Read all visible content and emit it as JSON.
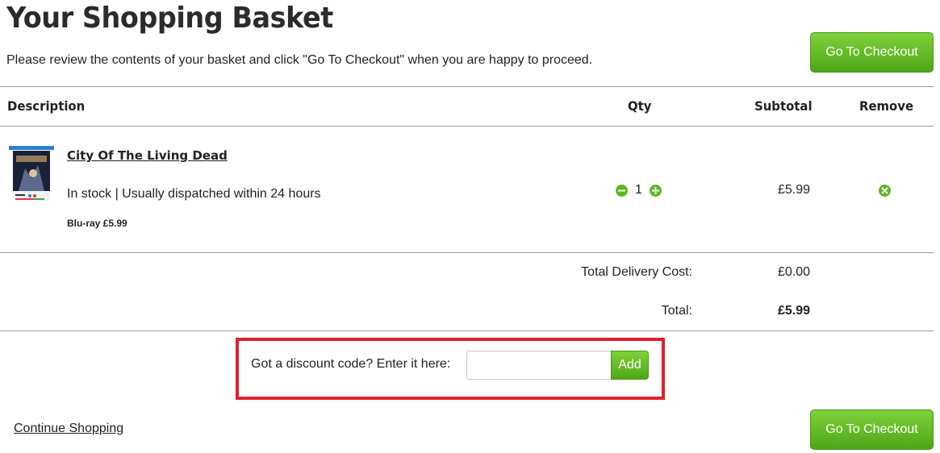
{
  "header": {
    "title": "Your Shopping Basket",
    "intro": "Please review the contents of your basket and click \"Go To Checkout\" when you are happy to proceed.",
    "checkout_label": "Go To Checkout"
  },
  "table": {
    "columns": {
      "description": "Description",
      "qty": "Qty",
      "subtotal": "Subtotal",
      "remove": "Remove"
    }
  },
  "item": {
    "title": "City Of The Living Dead",
    "stock": "In stock | Usually dispatched within 24 hours",
    "format": "Blu-ray £5.99",
    "qty": "1",
    "subtotal": "£5.99",
    "thumbnail_icon": "bluray-cover-image"
  },
  "totals": {
    "delivery_label": "Total Delivery Cost:",
    "delivery_value": "£0.00",
    "total_label": "Total:",
    "total_value": "£5.99"
  },
  "discount": {
    "label": "Got a discount code? Enter it here:",
    "placeholder": "",
    "value": "",
    "add_label": "Add"
  },
  "footer": {
    "continue_label": "Continue Shopping",
    "checkout_label": "Go To Checkout"
  },
  "colors": {
    "accent_green": "#5bb81f",
    "highlight_red": "#e1202e"
  }
}
